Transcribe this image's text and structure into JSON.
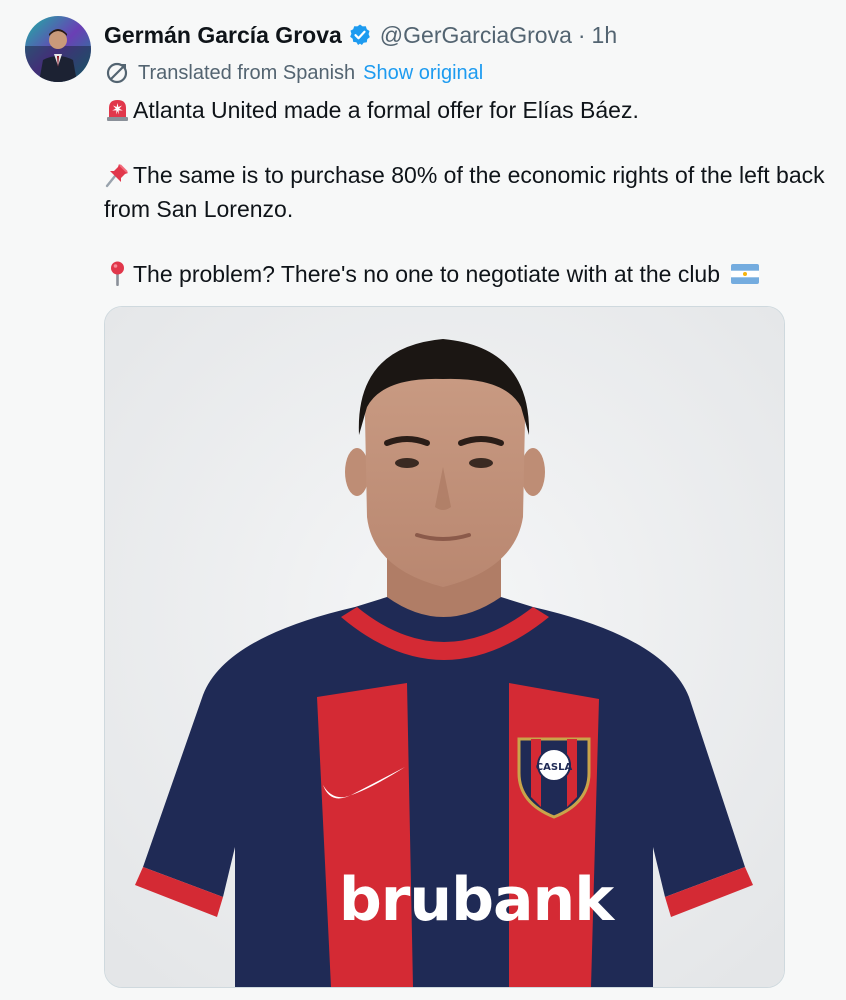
{
  "tweet": {
    "author_name": "Germán García Grova",
    "handle": "@GerGarciaGrova",
    "separator": "·",
    "timestamp": "1h",
    "translated_label": "Translated from Spanish",
    "show_original_label": "Show original",
    "lines": [
      "Atlanta United made a formal offer for Elías Báez.",
      "The same is to purchase 80% of the economic rights of the left back from San Lorenzo.",
      "The problem? There's no one to negotiate with at the club"
    ],
    "emoji": [
      "rotating-light-emoji",
      "pushpin-emoji",
      "round-pushpin-emoji",
      "argentina-flag-emoji"
    ]
  },
  "media": {
    "jersey_text": "brubank",
    "crest_text": "CASLA"
  },
  "colors": {
    "link": "#1d9bf0",
    "secondary_text": "#536471",
    "verified": "#1d9bf0",
    "jersey_navy": "#1f2a55",
    "jersey_red": "#d42a34"
  }
}
